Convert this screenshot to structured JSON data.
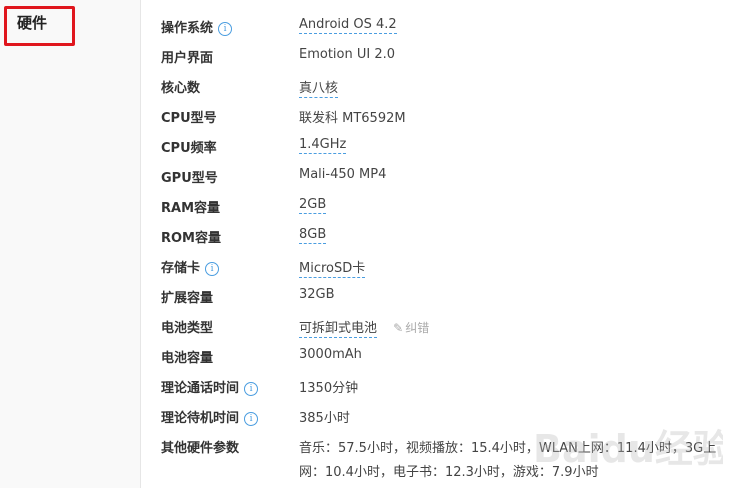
{
  "section": {
    "title": "硬件"
  },
  "specs": [
    {
      "label": "操作系统",
      "value": "Android OS 4.2"
    },
    {
      "label": "用户界面",
      "value": "Emotion UI 2.0"
    },
    {
      "label": "核心数",
      "value": "真八核"
    },
    {
      "label": "CPU型号",
      "value": "联发科 MT6592M"
    },
    {
      "label": "CPU频率",
      "value": "1.4GHz"
    },
    {
      "label": "GPU型号",
      "value": "Mali-450 MP4"
    },
    {
      "label": "RAM容量",
      "value": "2GB"
    },
    {
      "label": "ROM容量",
      "value": "8GB"
    },
    {
      "label": "存储卡",
      "value": "MicroSD卡"
    },
    {
      "label": "扩展容量",
      "value": "32GB"
    },
    {
      "label": "电池类型",
      "value": "可拆卸式电池"
    },
    {
      "label": "电池容量",
      "value": "3000mAh"
    },
    {
      "label": "理论通话时间",
      "value": "1350分钟"
    },
    {
      "label": "理论待机时间",
      "value": "385小时"
    },
    {
      "label": "其他硬件参数",
      "value": "音乐：57.5小时，视频播放：15.4小时，WLAN上网：11.4小时，3G上网：10.4小时，电子书：12.3小时，游戏：7.9小时"
    }
  ],
  "actions": {
    "correct_label": "纠错"
  },
  "watermark": {
    "text": "Baidu经验"
  }
}
